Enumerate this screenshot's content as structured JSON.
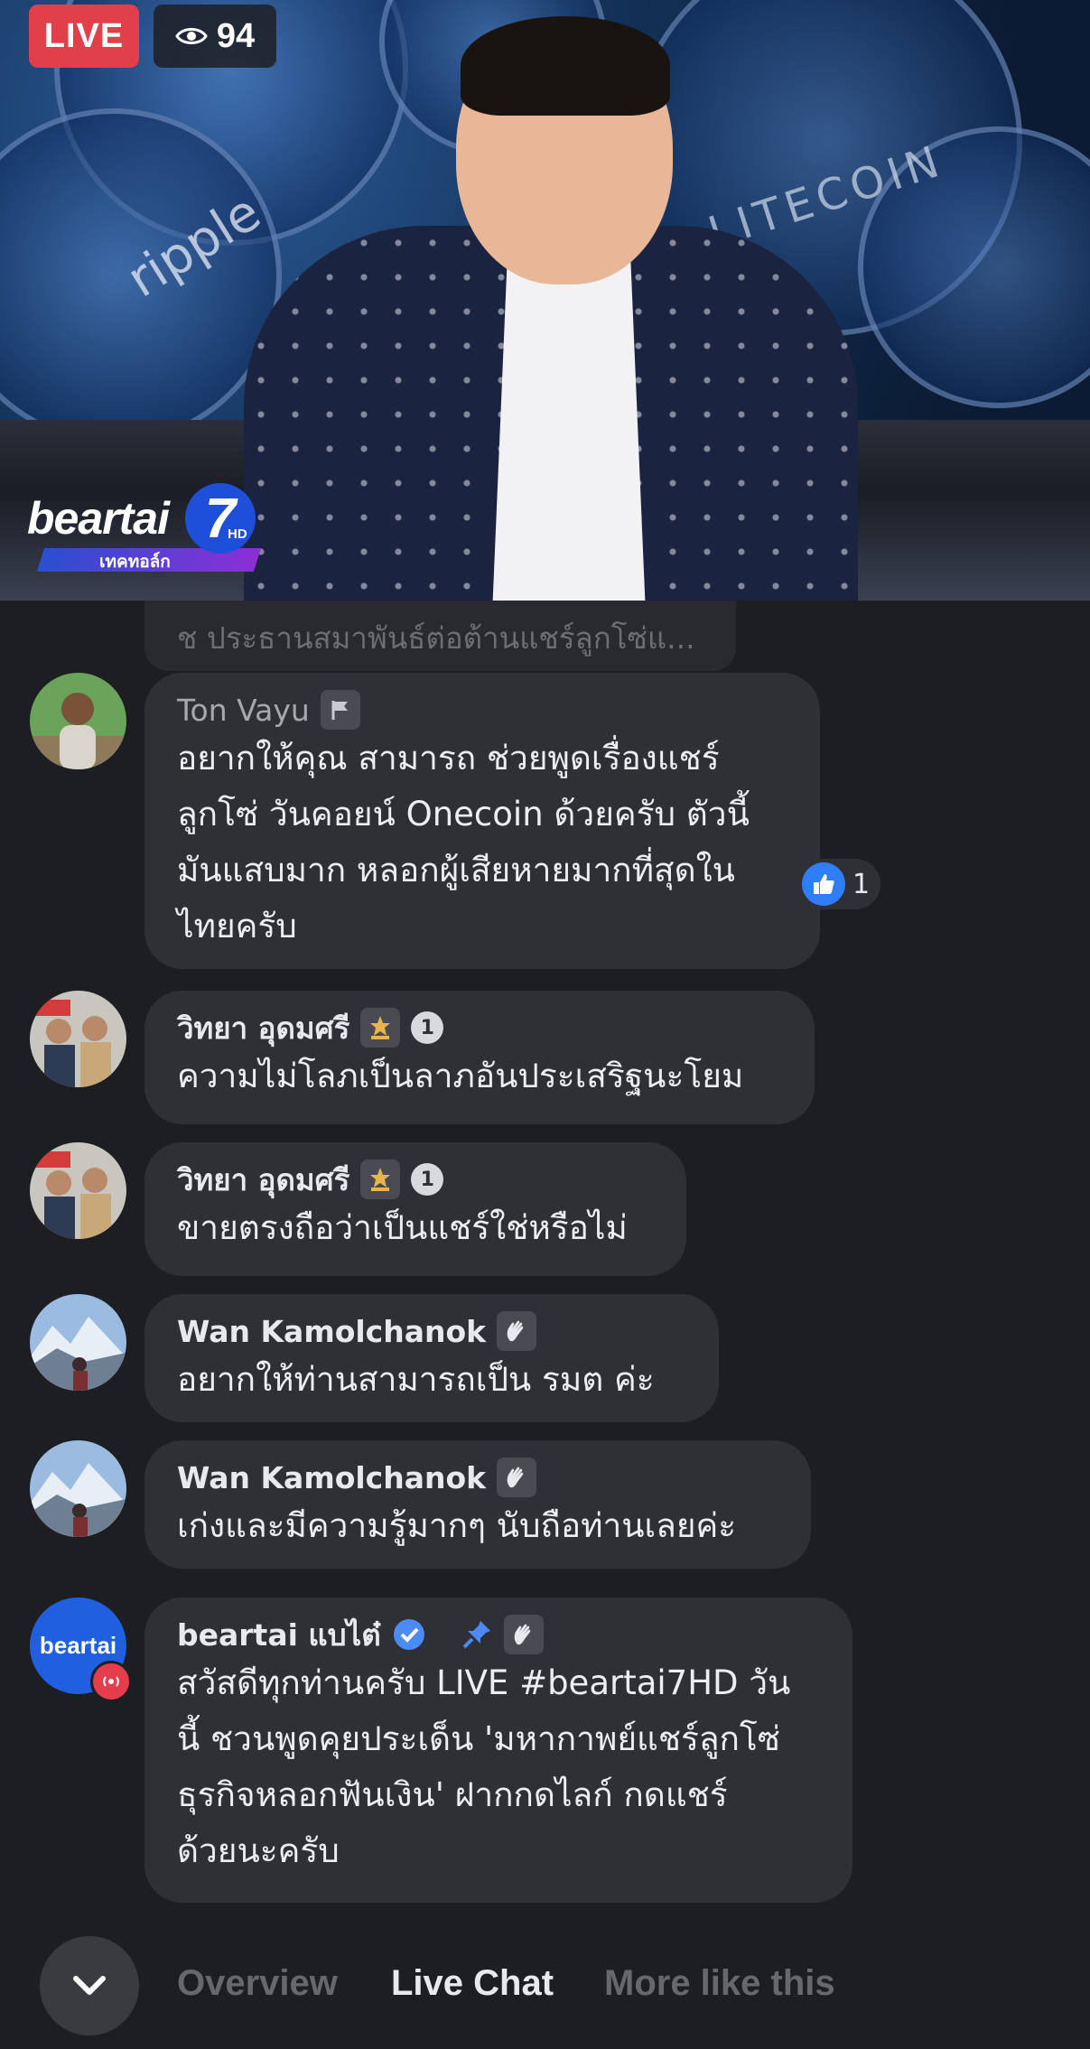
{
  "video": {
    "live_label": "LIVE",
    "viewer_count": "94",
    "logo_text": "beartai",
    "logo_number": "7",
    "logo_hd": "HD",
    "logo_subtitle": "เทคทอล์ก",
    "background_words": {
      "left": "ripple",
      "right": "LITECOIN"
    }
  },
  "chat": {
    "ghost_text": "ช ประธานสมาพันธ์ต่อต้านแชร์ลูกโซ่แ...",
    "messages": [
      {
        "author": "Ton Vayu",
        "badge": "flag-icon",
        "text_lines": [
          "อยากให้คุณ สามารถ ช่วยพูดเรื่องแชร์",
          "ลูกโซ่ วันคอยน์ Onecoin ด้วยครับ ตัวนี้",
          "มันแสบมาก หลอกผู้เสียหายมากที่สุดใน",
          "ไทยครับ"
        ],
        "reaction_count": "1"
      },
      {
        "author": "วิทยา อุดมศรี",
        "badge": "fan-icon",
        "rank": "1",
        "text_lines": [
          "ความไม่โลภเป็นลาภอันประเสริฐนะโยม"
        ]
      },
      {
        "author": "วิทยา อุดมศรี",
        "badge": "fan-icon",
        "rank": "1",
        "text_lines": [
          "ขายตรงถือว่าเป็นแชร์ใช่หรือไม่"
        ]
      },
      {
        "author": "Wan Kamolchanok",
        "badge": "wave-icon",
        "text_lines": [
          "อยากให้ท่านสามารถเป็น รมต ค่ะ"
        ]
      },
      {
        "author": "Wan Kamolchanok",
        "badge": "wave-icon",
        "text_lines": [
          "เก่งและมีความรู้มากๆ นับถือท่านเลยค่ะ"
        ]
      },
      {
        "author": "beartai แบไต๋",
        "badge": "verified-icon",
        "avatar_text": "beartai",
        "text_lines": [
          "สวัสดีทุกท่านครับ LIVE #beartai7HD วัน",
          "นี้ ชวนพูดคุยประเด็น 'มหากาพย์แชร์ลูกโซ่",
          "ธุรกิจหลอกฟันเงิน' ฝากกดไลก์ กดแชร์",
          "ด้วยนะครับ"
        ]
      }
    ]
  },
  "tabs": {
    "overview": "Overview",
    "live_chat": "Live Chat",
    "more_like_this": "More like this",
    "active": "Live Chat"
  },
  "colors": {
    "background": "#1d1e22",
    "bubble": "#2f3035",
    "live_red": "#e13f4a",
    "like_blue": "#2f7ef5",
    "verified_blue": "#4c8bf5"
  }
}
